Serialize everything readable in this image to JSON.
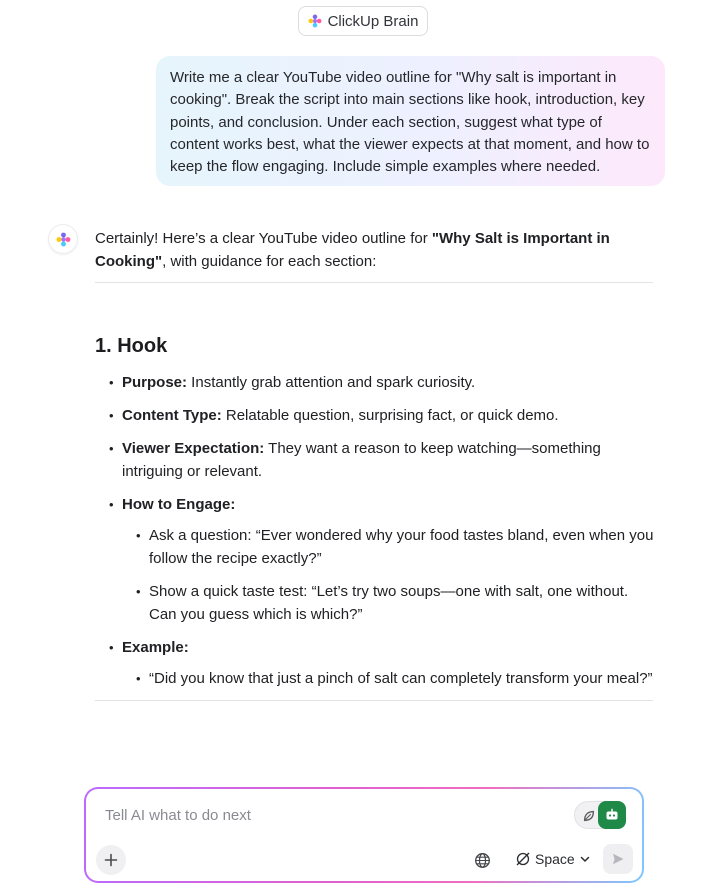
{
  "header": {
    "title": "ClickUp Brain",
    "icon": "clickup-brain-icon"
  },
  "user_message": {
    "text": "Write me a clear YouTube video outline for \"Why salt is important in cooking\". Break the script into main sections like hook, introduction, key points, and conclusion. Under each section, suggest what type of content works best, what the viewer expects at that moment, and how to keep the flow engaging. Include simple examples where needed."
  },
  "response": {
    "intro_before": "Certainly! Here’s a clear YouTube video outline for ",
    "intro_bold": "\"Why Salt is Important in Cooking\"",
    "intro_after": ", with guidance for each section:",
    "section_title": "1. Hook",
    "items": [
      {
        "label": "Purpose:",
        "text": " Instantly grab attention and spark curiosity."
      },
      {
        "label": "Content Type:",
        "text": " Relatable question, surprising fact, or quick demo."
      },
      {
        "label": "Viewer Expectation:",
        "text": " They want a reason to keep watching—something intriguing or relevant."
      },
      {
        "label": "How to Engage:",
        "text": ""
      },
      {
        "label": "Example:",
        "text": ""
      }
    ],
    "engage_subitems": [
      "Ask a question: “Ever wondered why your food tastes bland, even when you follow the recipe exactly?”",
      "Show a quick taste test: “Let’s try two soups—one with salt, one without. Can you guess which is which?”"
    ],
    "example_subitems": [
      "“Did you know that just a pinch of salt can completely transform your meal?”"
    ]
  },
  "composer": {
    "placeholder": "Tell AI what to do next",
    "space_label": "Space",
    "icons": {
      "add": "plus-icon",
      "web": "globe-icon",
      "space": "space-icon",
      "send": "send-icon",
      "leaf": "leaf-icon",
      "agent": "robot-icon"
    }
  },
  "colors": {
    "agent_green": "#1f8a48",
    "composer_border_start": "#bb6bff",
    "composer_border_end": "#7ec8ff"
  }
}
